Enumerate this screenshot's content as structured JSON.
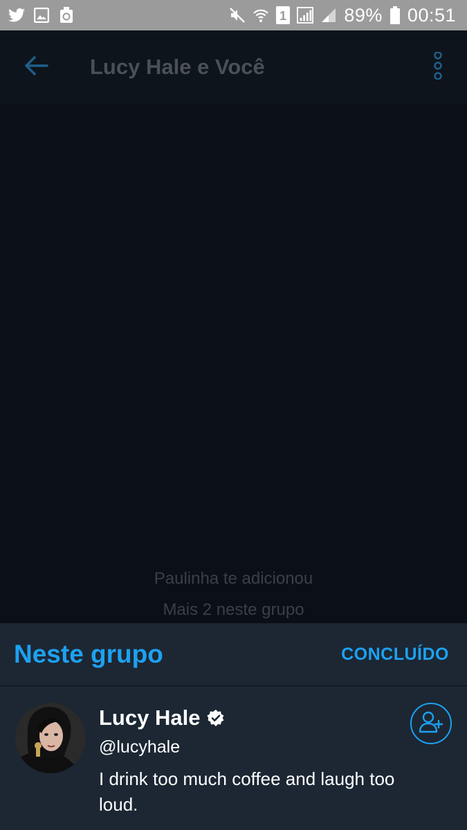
{
  "status_bar": {
    "battery_percent": "89%",
    "time": "00:51",
    "sim_slot": "1",
    "icons": [
      "twitter-icon",
      "gallery-icon",
      "recycle-icon",
      "mute-icon",
      "wifi-icon",
      "sim-icon",
      "signal-icon",
      "signal-2-icon",
      "battery-icon"
    ]
  },
  "app_bar": {
    "title": "Lucy Hale e Você",
    "back_icon": "arrow-left-icon",
    "more_icon": "more-vertical-icon"
  },
  "chat": {
    "system_messages": [
      "Paulinha te adicionou",
      "Mais 2 neste grupo"
    ]
  },
  "sheet": {
    "title": "Neste grupo",
    "done_label": "CONCLUÍDO",
    "members": [
      {
        "name": "Lucy Hale",
        "handle": "@lucyhale",
        "bio": "I drink too much coffee and laugh too loud.",
        "verified": true
      }
    ]
  },
  "colors": {
    "accent": "#1da1f2",
    "background": "#0b1017",
    "sheet": "#1c2733",
    "status_bar": "#9b9b9b"
  }
}
